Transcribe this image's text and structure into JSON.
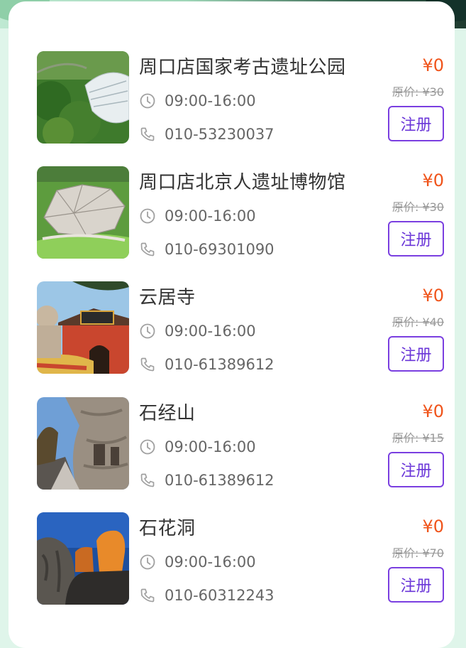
{
  "colors": {
    "price": "#f0541b",
    "accent": "#6a35d8",
    "title": "#333333",
    "meta": "#666666",
    "strike": "#999999"
  },
  "venues": [
    {
      "name": "周口店国家考古遗址公园",
      "hours": "09:00-16:00",
      "phone": "010-53230037",
      "price": "¥0",
      "original_price": "原价: ¥30",
      "button_label": "注册",
      "image": "archaeological-park-photo"
    },
    {
      "name": "周口店北京人遗址博物馆",
      "hours": "09:00-16:00",
      "phone": "010-69301090",
      "price": "¥0",
      "original_price": "原价: ¥30",
      "button_label": "注册",
      "image": "museum-aerial-photo"
    },
    {
      "name": "云居寺",
      "hours": "09:00-16:00",
      "phone": "010-61389612",
      "price": "¥0",
      "original_price": "原价: ¥40",
      "button_label": "注册",
      "image": "temple-gate-photo"
    },
    {
      "name": "石经山",
      "hours": "09:00-16:00",
      "phone": "010-61389612",
      "price": "¥0",
      "original_price": "原价: ¥15",
      "button_label": "注册",
      "image": "cliff-cave-photo"
    },
    {
      "name": "石花洞",
      "hours": "09:00-16:00",
      "phone": "010-60312243",
      "price": "¥0",
      "original_price": "原价: ¥70",
      "button_label": "注册",
      "image": "cave-formation-photo"
    }
  ]
}
